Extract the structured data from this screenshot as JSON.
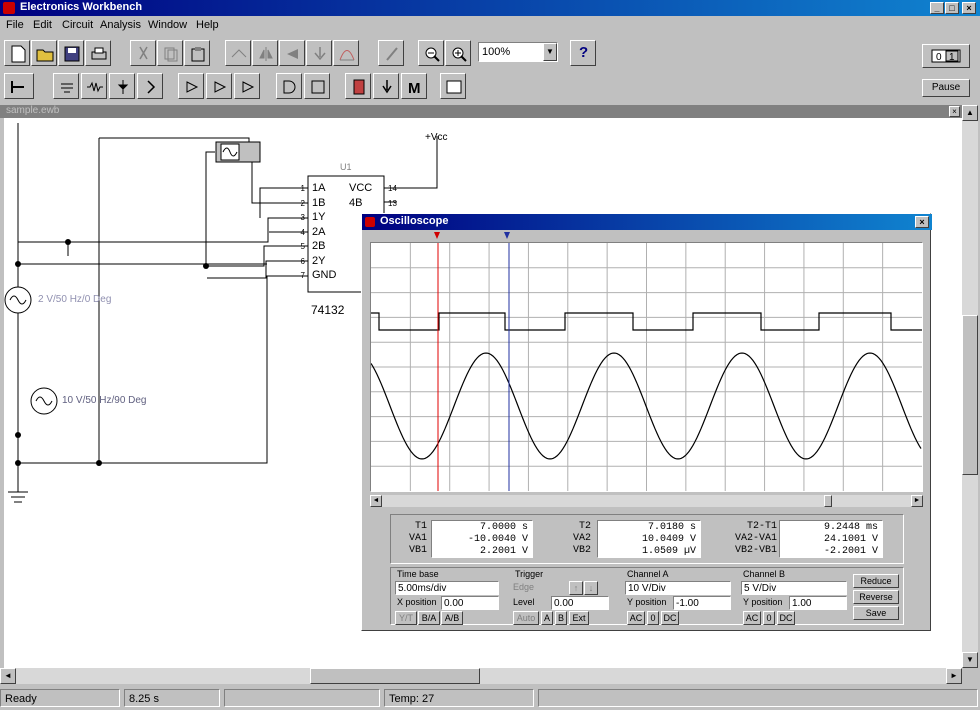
{
  "app": {
    "title": "Electronics Workbench"
  },
  "menu": [
    "File",
    "Edit",
    "Circuit",
    "Analysis",
    "Window",
    "Help"
  ],
  "toolbar": {
    "zoom": "100%",
    "help": "?",
    "pause": "Pause",
    "power_icon": "power-switch-icon"
  },
  "circuit": {
    "window_title": "sample.ewb",
    "chip": {
      "label": "U1",
      "part": "74132",
      "pins_left": [
        "1A",
        "1B",
        "1Y",
        "2A",
        "2B",
        "2Y",
        "GND"
      ],
      "pins_left_nums": [
        "1",
        "2",
        "3",
        "4",
        "5",
        "6",
        "7"
      ],
      "pins_right": [
        "VCC",
        "4B"
      ],
      "pins_right_nums": [
        "14",
        "13"
      ]
    },
    "vcc": "+Vcc",
    "source1": "2 V/50 Hz/0 Deg",
    "source2": "10 V/50 Hz/90 Deg"
  },
  "osc": {
    "title": "Oscilloscope",
    "t1_label": "T1",
    "va1_label": "VA1",
    "vb1_label": "VB1",
    "t1": "7.0000   s",
    "va1": "-10.0040   V",
    "vb1": "2.2001   V",
    "t2_label": "T2",
    "va2_label": "VA2",
    "vb2_label": "VB2",
    "t2": "7.0180   s",
    "va2": "10.0409   V",
    "vb2": "1.0509   µV",
    "dt_label": "T2-T1",
    "dva_label": "VA2-VA1",
    "dvb_label": "VB2-VB1",
    "dt": "9.2448   ms",
    "dva": "24.1001   V",
    "dvb": "-2.2001   V",
    "timebase": {
      "label": "Time base",
      "value": "5.00ms/div",
      "xpos_label": "X position",
      "xpos": "0.00",
      "modes": [
        "Y/T",
        "B/A",
        "A/B"
      ]
    },
    "trigger": {
      "label": "Trigger",
      "edge": "Edge",
      "level_label": "Level",
      "level": "0.00",
      "modes": [
        "Auto",
        "A",
        "B",
        "Ext"
      ]
    },
    "channelA": {
      "label": "Channel A",
      "value": "10 V/Div",
      "ypos_label": "Y position",
      "ypos": "-1.00",
      "modes": [
        "AC",
        "0",
        "DC"
      ]
    },
    "channelB": {
      "label": "Channel B",
      "value": "5 V/Div",
      "ypos_label": "Y position",
      "ypos": "1.00",
      "modes": [
        "AC",
        "0",
        "DC"
      ]
    },
    "buttons": [
      "Reduce",
      "Reverse",
      "Save"
    ]
  },
  "status": {
    "state": "Ready",
    "time": "8.25 s",
    "temp": "Temp: 27"
  }
}
